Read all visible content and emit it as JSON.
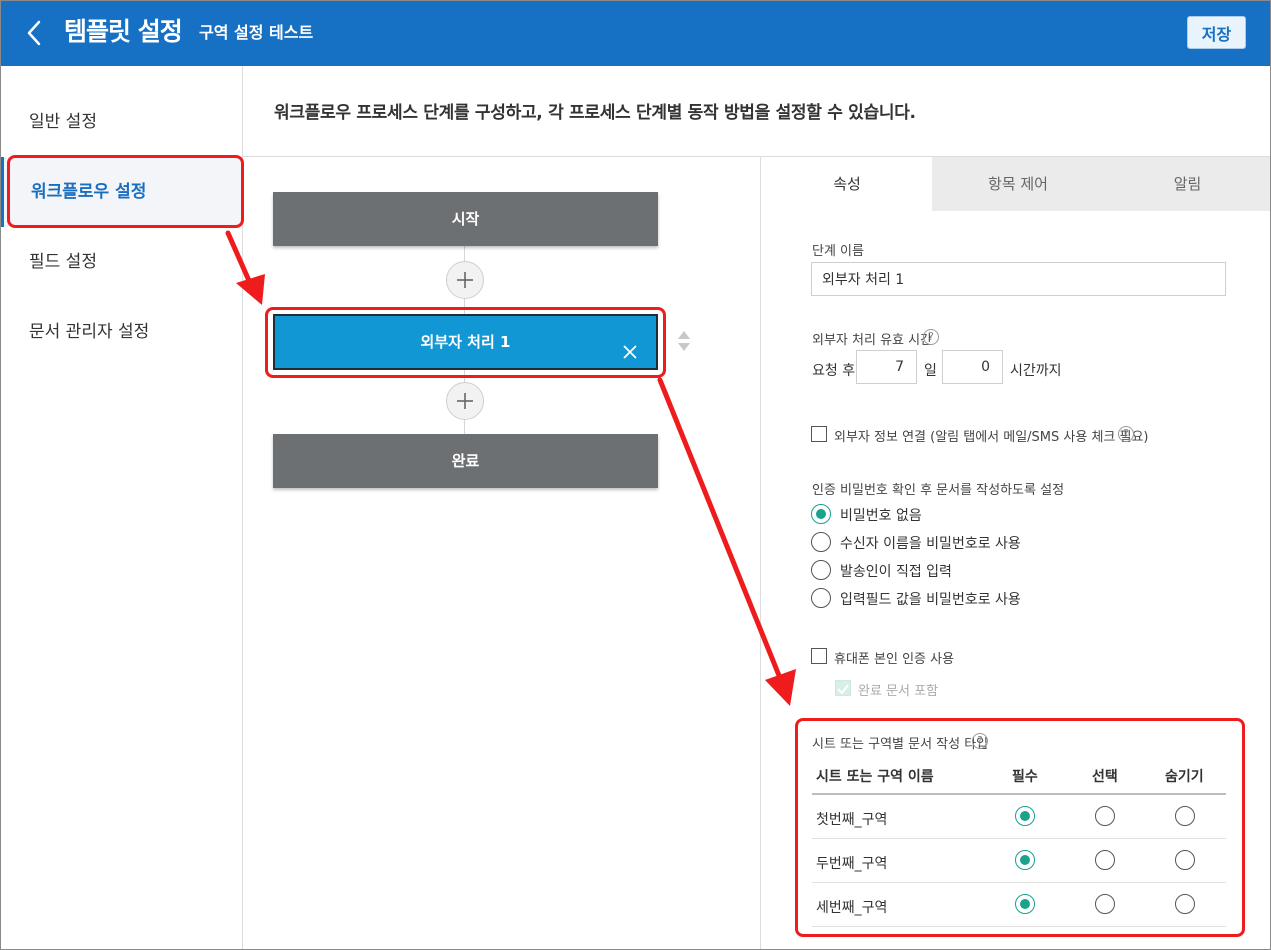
{
  "header": {
    "title": "템플릿 설정",
    "subtitle": "구역 설정 테스트",
    "save_label": "저장"
  },
  "sidebar": {
    "items": [
      {
        "label": "일반 설정"
      },
      {
        "label": "워크플로우 설정"
      },
      {
        "label": "필드 설정"
      },
      {
        "label": "문서 관리자 설정"
      }
    ]
  },
  "content": {
    "description": "워크플로우 프로세스 단계를 구성하고, 각 프로세스 단계별 동작 방법을 설정할 수 있습니다."
  },
  "workflow": {
    "start_label": "시작",
    "active_step_label": "외부자 처리 1",
    "end_label": "완료"
  },
  "tabs": [
    {
      "label": "속성"
    },
    {
      "label": "항목 제어"
    },
    {
      "label": "알림"
    }
  ],
  "properties": {
    "step_name_label": "단계 이름",
    "step_name_value": "외부자 처리 1",
    "validity_label": "외부자 처리 유효 시간",
    "request_after": "요청 후",
    "days_value": "7",
    "days_unit": "일",
    "hours_value": "0",
    "hours_unit": "시간까지",
    "external_info_label": "외부자 정보 연결 (알림 탭에서 메일/SMS 사용 체크 필요)",
    "password_section_label": "인증 비밀번호 확인 후 문서를 작성하도록 설정",
    "password_options": [
      {
        "label": "비밀번호 없음"
      },
      {
        "label": "수신자 이름을 비밀번호로 사용"
      },
      {
        "label": "발송인이 직접 입력"
      },
      {
        "label": "입력필드 값을 비밀번호로 사용"
      }
    ],
    "phone_auth_label": "휴대폰 본인 인증 사용",
    "include_complete_label": "완료 문서 포함",
    "help_glyph": "?"
  },
  "zone_table": {
    "title": "시트 또는 구역별 문서 작성 타입",
    "headers": [
      "시트 또는 구역 이름",
      "필수",
      "선택",
      "숨기기"
    ],
    "rows": [
      {
        "name": "첫번째_구역",
        "selected": "필수"
      },
      {
        "name": "두번째_구역",
        "selected": "필수"
      },
      {
        "name": "세번째_구역",
        "selected": "필수"
      }
    ]
  },
  "colors": {
    "header_bg": "#1670c4",
    "active_step": "#1198d4",
    "radio_accent": "#19a28e",
    "annotation": "#ee1c1c"
  }
}
